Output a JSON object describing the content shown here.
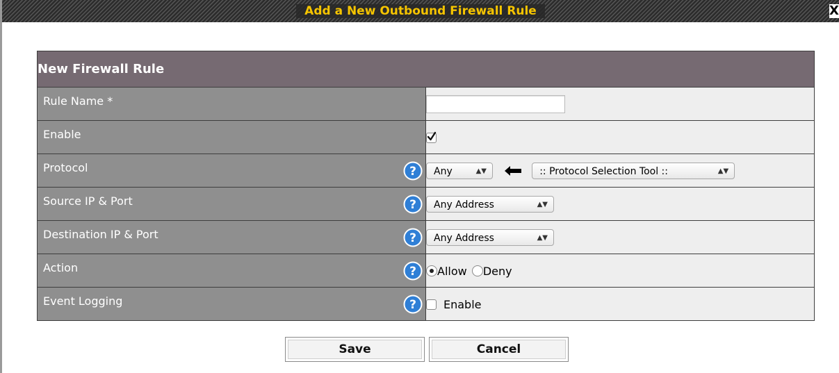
{
  "dialog": {
    "title": "Add a New Outbound Firewall Rule",
    "close_label": "X"
  },
  "table": {
    "header": "New Firewall Rule",
    "rows": {
      "rule_name": {
        "label": "Rule Name *",
        "value": ""
      },
      "enable": {
        "label": "Enable",
        "checked": true
      },
      "protocol": {
        "label": "Protocol",
        "selected": "Any",
        "tool_selected": ":: Protocol Selection Tool ::"
      },
      "source": {
        "label": "Source IP & Port",
        "selected": "Any Address"
      },
      "destination": {
        "label": "Destination IP & Port",
        "selected": "Any Address"
      },
      "action": {
        "label": "Action",
        "options": [
          "Allow",
          "Deny"
        ],
        "selected": "Allow"
      },
      "event_logging": {
        "label": "Event Logging",
        "option_label": "Enable",
        "checked": false
      }
    }
  },
  "buttons": {
    "save": "Save",
    "cancel": "Cancel"
  },
  "colors": {
    "title": "#f5c400",
    "header_bg": "#766a72",
    "label_bg": "#8f8f8f",
    "value_bg": "#eeeeee",
    "help_icon": "#2f7fd6"
  },
  "icons": {
    "help": "question-circle-icon",
    "arrow": "arrow-left-icon",
    "check": "checkmark-icon",
    "close": "close-icon"
  }
}
